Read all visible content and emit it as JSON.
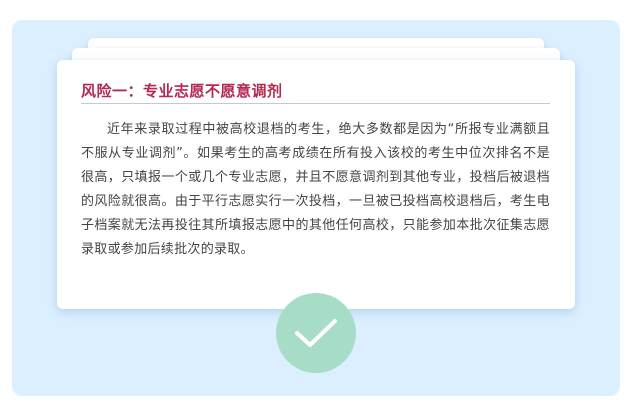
{
  "card": {
    "title": "风险一：专业志愿不愿意调剂",
    "body": "近年来录取过程中被高校退档的考生，绝大多数都是因为“所报专业满额且不服从专业调剂”。如果考生的高考成绩在所有投入该校的考生中位次排名不是很高，只填报一个或几个专业志愿，并且不愿意调剂到其他专业，投档后被退档的风险就很高。由于平行志愿实行一次投档，一旦被已投档高校退档后，考生电子档案就无法再投往其所填报志愿中的其他任何高校，只能参加本批次征集志愿录取或参加后续批次的录取。"
  },
  "colors": {
    "panel_background": "#dcefff",
    "title": "#b5294f",
    "body_text": "#444444",
    "check_badge": "#a7dcc6"
  },
  "icons": {
    "badge": "checkmark-icon"
  }
}
